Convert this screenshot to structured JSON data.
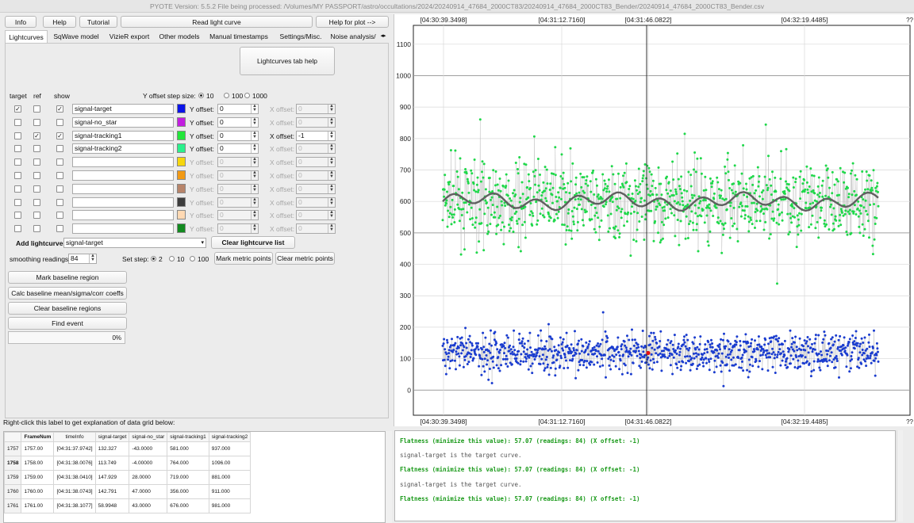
{
  "window": {
    "title": "PYOTE Version: 5.5.2  File being processed: /Volumes/MY PASSPORT/astro/occultations/2024/20240914_47684_2000CT83/20240914_47684_2000CT83_Bender/20240914_47684_2000CT83_Bender.csv"
  },
  "toolbar": {
    "info": "Info",
    "help": "Help",
    "tutorial": "Tutorial",
    "read_lc": "Read light curve",
    "help_plot": "Help for plot -->"
  },
  "tabs": [
    "Lightcurves",
    "SqWave model",
    "VizieR export",
    "Other models",
    "Manual timestamps",
    "Settings/Misc.",
    "Noise analysis/"
  ],
  "tab_help": "Lightcurves tab help",
  "headers": {
    "target": "target",
    "ref": "ref",
    "show": "show"
  },
  "yoffset": {
    "label": "Y offset step size:",
    "opts": [
      "10",
      "100",
      "1000"
    ],
    "selected": 0
  },
  "rows": [
    {
      "target": true,
      "ref": false,
      "show": true,
      "name": "signal-target",
      "color": "#0a14e8",
      "y": "0",
      "x": "0",
      "yen": true,
      "xen": false
    },
    {
      "target": false,
      "ref": false,
      "show": false,
      "name": "signal-no_star",
      "color": "#c21fe0",
      "y": "0",
      "x": "0",
      "yen": true,
      "xen": false
    },
    {
      "target": false,
      "ref": true,
      "show": true,
      "name": "signal-tracking1",
      "color": "#22e63a",
      "y": "0",
      "x": "-1",
      "yen": true,
      "xen": true
    },
    {
      "target": false,
      "ref": false,
      "show": false,
      "name": "signal-tracking2",
      "color": "#2bf08c",
      "y": "0",
      "x": "0",
      "yen": true,
      "xen": false
    },
    {
      "target": false,
      "ref": false,
      "show": false,
      "name": "",
      "color": "#f6d60c",
      "y": "0",
      "x": "0",
      "yen": false,
      "xen": false
    },
    {
      "target": false,
      "ref": false,
      "show": false,
      "name": "",
      "color": "#f29a14",
      "y": "0",
      "x": "0",
      "yen": false,
      "xen": false
    },
    {
      "target": false,
      "ref": false,
      "show": false,
      "name": "",
      "color": "#b7846a",
      "y": "0",
      "x": "0",
      "yen": false,
      "xen": false
    },
    {
      "target": false,
      "ref": false,
      "show": false,
      "name": "",
      "color": "#3d3d3d",
      "y": "0",
      "x": "0",
      "yen": false,
      "xen": false
    },
    {
      "target": false,
      "ref": false,
      "show": false,
      "name": "",
      "color": "#ffd9b3",
      "y": "0",
      "x": "0",
      "yen": false,
      "xen": false
    },
    {
      "target": false,
      "ref": false,
      "show": false,
      "name": "",
      "color": "#128a1f",
      "y": "0",
      "x": "0",
      "yen": false,
      "xen": false
    }
  ],
  "labels": {
    "yoff": "Y offset:",
    "xoff": "X offset:"
  },
  "add_lc": {
    "label": "Add lightcurve",
    "value": "signal-target",
    "clear": "Clear lightcurve list"
  },
  "smoothing": {
    "label": "smoothing readings",
    "value": "84"
  },
  "setstep": {
    "label": "Set step:",
    "opts": [
      "2",
      "10",
      "100"
    ],
    "selected": 0
  },
  "metric": {
    "mark": "Mark metric points",
    "clear": "Clear metric points"
  },
  "actions": {
    "mark_baseline": "Mark baseline region",
    "calc_baseline": "Calc baseline mean/sigma/corr coeffs",
    "clear_baseline": "Clear baseline regions",
    "find_event": "Find event"
  },
  "progress": {
    "value": 0,
    "text": "0%"
  },
  "grid_label": "Right-click this label to get explanation of data grid below:",
  "grid": {
    "columns": [
      "FrameNum",
      "timeInfo",
      "signal-target",
      "signal-no_star",
      "signal-tracking1",
      "signal-tracking2"
    ],
    "rows": [
      {
        "idx": "1757",
        "cells": [
          "1757.00",
          "[04:31:37.9742]",
          "132.327",
          "-43.0000",
          "581.000",
          "937.000"
        ]
      },
      {
        "idx": "1758",
        "cells": [
          "1758.00",
          "[04:31:38.0076]",
          "113.749",
          "-4.00000",
          "764.000",
          "1096.00"
        ]
      },
      {
        "idx": "1759",
        "cells": [
          "1759.00",
          "[04:31:38.0410]",
          "147.929",
          "28.0000",
          "719.000",
          "881.000"
        ]
      },
      {
        "idx": "1760",
        "cells": [
          "1760.00",
          "[04:31:38.0743]",
          "142.791",
          "47.0000",
          "356.000",
          "911.000"
        ]
      },
      {
        "idx": "1761",
        "cells": [
          "1761.00",
          "[04:31:38.1077]",
          "58.9948",
          "43.0000",
          "676.000",
          "981.000"
        ]
      }
    ]
  },
  "log": [
    "Flatness (minimize this value): 57.07 (readings: 84) (X offset: -1)",
    "signal-target is the target curve.",
    "Flatness (minimize this value): 57.07 (readings: 84) (X offset: -1)",
    "signal-target is the target curve.",
    "Flatness (minimize this value): 57.07 (readings: 84) (X offset: -1)"
  ],
  "chart_data": {
    "type": "scatter",
    "x_tick_labels": [
      "[04:30:39.3498]",
      "[04:31:12.7160]",
      "[04:31:46.0822]",
      "[04:32:19.4485]"
    ],
    "corner_label": "??",
    "y_ticks": [
      0,
      100,
      200,
      300,
      400,
      500,
      600,
      700,
      800,
      900,
      1000,
      1100
    ],
    "ylim": [
      -80,
      1160
    ],
    "series": [
      {
        "color": "#1fd84a",
        "mean": 600,
        "spread": 110,
        "count": 1000
      },
      {
        "color": "#1a3ccf",
        "mean": 120,
        "spread": 55,
        "count": 1000
      }
    ],
    "smoothed_color": "#606060",
    "smoothed_level": 600,
    "highlight_point": {
      "color": "#e81010",
      "y": 118
    },
    "cursor_time": "[04:31:46.0822]"
  }
}
